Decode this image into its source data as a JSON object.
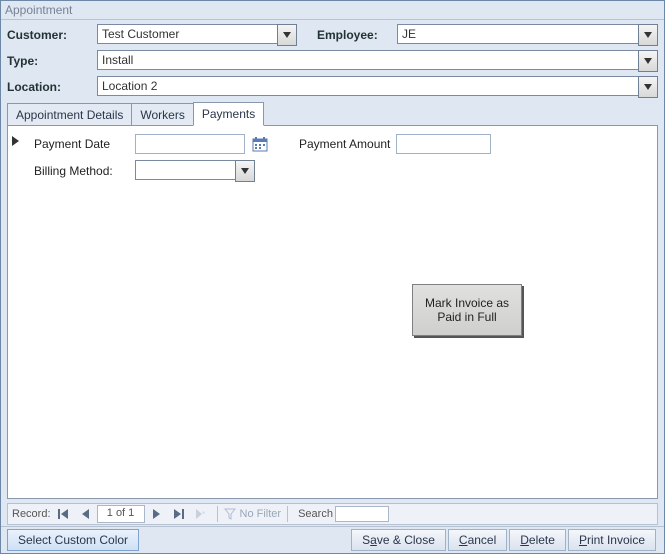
{
  "window": {
    "title": "Appointment"
  },
  "header": {
    "customer_label": "Customer:",
    "customer_value": "Test Customer",
    "employee_label": "Employee:",
    "employee_value": "JE",
    "type_label": "Type:",
    "type_value": "Install",
    "location_label": "Location:",
    "location_value": "Location 2"
  },
  "tabs": {
    "appointment_details": "Appointment Details",
    "workers": "Workers",
    "payments": "Payments",
    "active": "payments"
  },
  "payments": {
    "payment_date_label": "Payment Date",
    "payment_date_value": "",
    "payment_amount_label": "Payment Amount",
    "payment_amount_value": "",
    "billing_method_label": "Billing Method:",
    "billing_method_value": "",
    "mark_paid_button": "Mark Invoice as Paid in Full"
  },
  "recordnav": {
    "label": "Record:",
    "position": "1 of 1",
    "no_filter": "No Filter",
    "search_label": "Search",
    "search_value": ""
  },
  "footer": {
    "select_color": "Select Custom Color",
    "save_close_pre": "S",
    "save_close_u": "a",
    "save_close_post": "ve & Close",
    "cancel_u": "C",
    "cancel_post": "ancel",
    "delete_u": "D",
    "delete_post": "elete",
    "print_u": "P",
    "print_post": "rint Invoice"
  }
}
